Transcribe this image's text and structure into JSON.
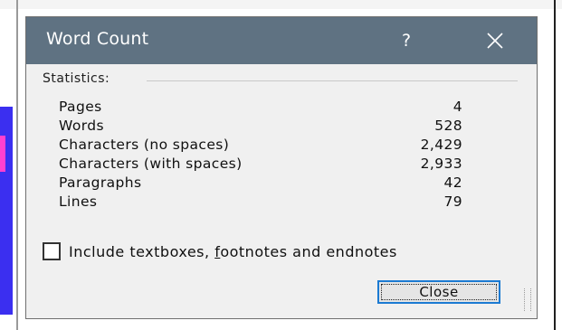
{
  "dialog": {
    "title": "Word Count",
    "help_label": "?",
    "close_icon": "close-icon",
    "group_label": "Statistics:",
    "stats": [
      {
        "label": "Pages",
        "value": "4"
      },
      {
        "label": "Words",
        "value": "528"
      },
      {
        "label": "Characters (no spaces)",
        "value": "2,429"
      },
      {
        "label": "Characters (with spaces)",
        "value": "2,933"
      },
      {
        "label": "Paragraphs",
        "value": "42"
      },
      {
        "label": "Lines",
        "value": "79"
      }
    ],
    "checkbox": {
      "checked": false,
      "label_before": "Include textboxes, ",
      "label_underlined": "f",
      "label_after": "ootnotes and endnotes"
    },
    "close_button_label": "Close"
  },
  "colors": {
    "titlebar": "#5f7282",
    "dialog_bg": "#f0f0f0",
    "focus_border": "#1b7ad2"
  }
}
